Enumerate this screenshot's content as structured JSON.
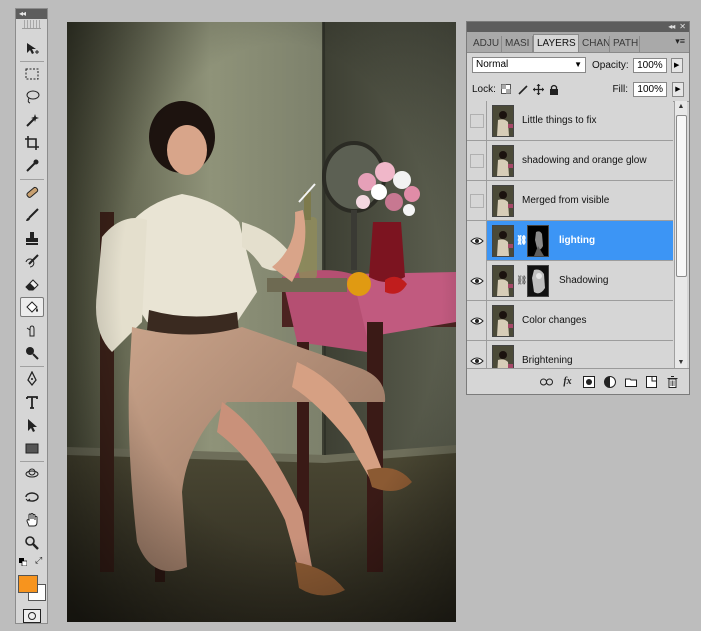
{
  "toolbox": {
    "collapse_label": "◂◂",
    "tools": [
      "move",
      "marquee",
      "lasso",
      "quick-selection",
      "crop",
      "eyedropper",
      "spot-healing",
      "brush",
      "clone-stamp",
      "history-brush",
      "eraser",
      "paint-bucket",
      "blur",
      "dodge",
      "pen",
      "type",
      "path-selection",
      "rectangle",
      "3d-rotate",
      "3d-orbit",
      "hand",
      "zoom"
    ],
    "foreground_color": "#f7941e",
    "background_color": "#ffffff"
  },
  "panel": {
    "collapse_label": "◂◂",
    "close_label": "✕",
    "tabs": [
      "ADJU",
      "MASI",
      "LAYERS",
      "CHAN",
      "PATH"
    ],
    "active_tab": "LAYERS",
    "blend_mode": "Normal",
    "opacity_label": "Opacity:",
    "opacity_value": "100%",
    "lock_label": "Lock:",
    "fill_label": "Fill:",
    "fill_value": "100%",
    "layers": [
      {
        "name": "Little things to fix",
        "visible": false,
        "mask": false,
        "selected": false
      },
      {
        "name": "shadowing and orange glow",
        "visible": false,
        "mask": false,
        "selected": false
      },
      {
        "name": "Merged from visible",
        "visible": false,
        "mask": false,
        "selected": false
      },
      {
        "name": "lighting",
        "visible": true,
        "mask": true,
        "selected": true
      },
      {
        "name": "Shadowing",
        "visible": true,
        "mask": true,
        "selected": false
      },
      {
        "name": "Color changes",
        "visible": true,
        "mask": false,
        "selected": false
      },
      {
        "name": "Brightening",
        "visible": true,
        "mask": false,
        "selected": false
      }
    ],
    "bottom_icons": [
      "link-icon",
      "fx-icon",
      "add-mask-icon",
      "adjustment-icon",
      "group-icon",
      "new-layer-icon",
      "trash-icon"
    ],
    "fx_label": "fx"
  }
}
